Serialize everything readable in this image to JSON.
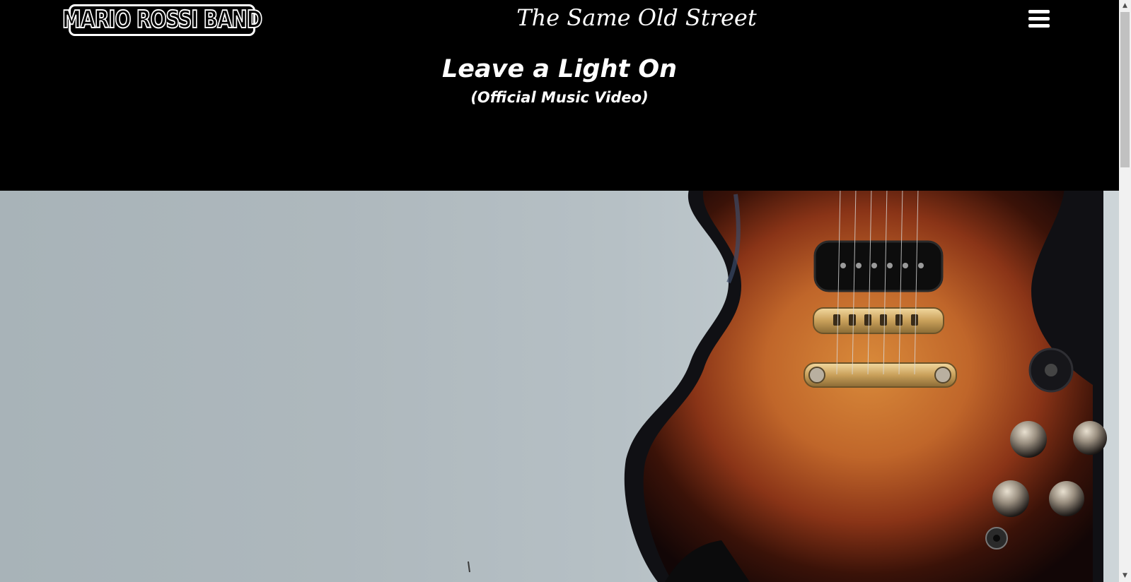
{
  "header": {
    "logo_text": "MARIO ROSSI BAND",
    "album_title": "The Same Old Street",
    "menu_icon": "hamburger-menu-icon"
  },
  "video": {
    "title": "Leave a Light On",
    "subtitle": "(Official Music Video)",
    "thumbnail_subject": "sunburst electric guitar"
  },
  "colors": {
    "background": "#000000",
    "text": "#ffffff",
    "guitar_sunburst": "#b35a1f"
  }
}
